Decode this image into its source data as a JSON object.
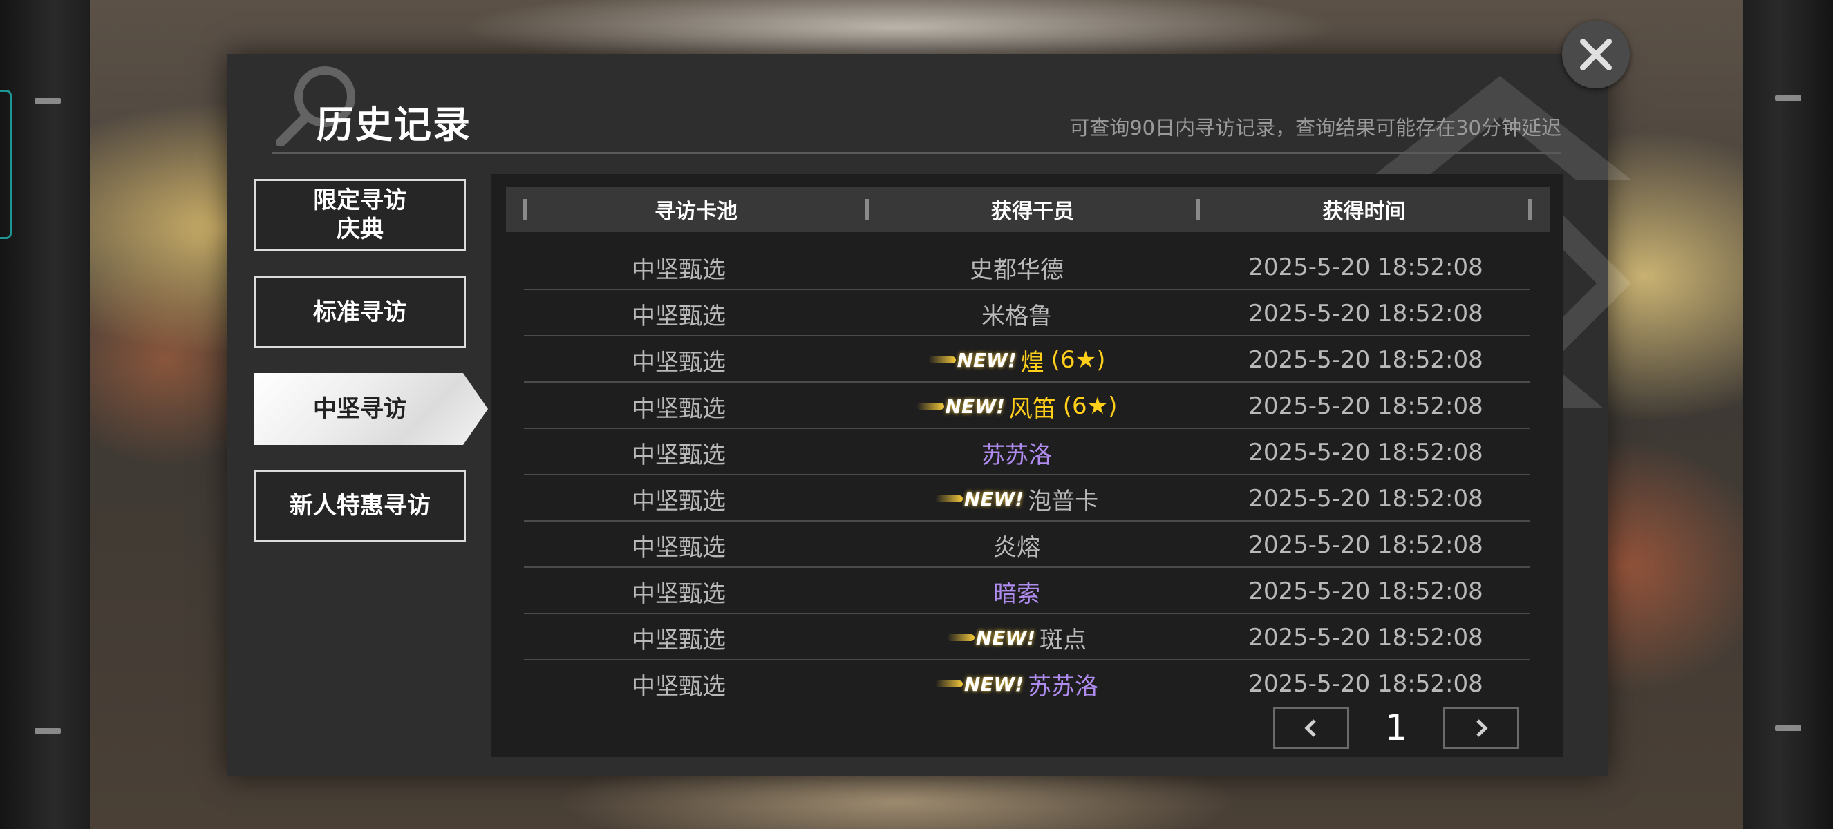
{
  "dialog": {
    "title": "历史记录",
    "subtitle": "可查询90日内寻访记录，查询结果可能存在30分钟延迟"
  },
  "tabs": [
    {
      "label": "限定寻访\n庆典",
      "active": false
    },
    {
      "label": "标准寻访",
      "active": false
    },
    {
      "label": "中坚寻访",
      "active": true
    },
    {
      "label": "新人特惠寻访",
      "active": false
    }
  ],
  "table": {
    "headers": [
      "寻访卡池",
      "获得干员",
      "获得时间"
    ],
    "rows": [
      {
        "pool": "中坚甄选",
        "operator": "史都华德",
        "is_new": false,
        "rarity_label": "",
        "tier": "normal",
        "time": "2025-5-20 18:52:08"
      },
      {
        "pool": "中坚甄选",
        "operator": "米格鲁",
        "is_new": false,
        "rarity_label": "",
        "tier": "normal",
        "time": "2025-5-20 18:52:08"
      },
      {
        "pool": "中坚甄选",
        "operator": "煌",
        "is_new": true,
        "rarity_label": "(6★)",
        "tier": "six",
        "time": "2025-5-20 18:52:08"
      },
      {
        "pool": "中坚甄选",
        "operator": "风笛",
        "is_new": true,
        "rarity_label": "(6★)",
        "tier": "six",
        "time": "2025-5-20 18:52:08"
      },
      {
        "pool": "中坚甄选",
        "operator": "苏苏洛",
        "is_new": false,
        "rarity_label": "",
        "tier": "five",
        "time": "2025-5-20 18:52:08"
      },
      {
        "pool": "中坚甄选",
        "operator": "泡普卡",
        "is_new": true,
        "rarity_label": "",
        "tier": "normal",
        "time": "2025-5-20 18:52:08"
      },
      {
        "pool": "中坚甄选",
        "operator": "炎熔",
        "is_new": false,
        "rarity_label": "",
        "tier": "normal",
        "time": "2025-5-20 18:52:08"
      },
      {
        "pool": "中坚甄选",
        "operator": "暗索",
        "is_new": false,
        "rarity_label": "",
        "tier": "five",
        "time": "2025-5-20 18:52:08"
      },
      {
        "pool": "中坚甄选",
        "operator": "斑点",
        "is_new": true,
        "rarity_label": "",
        "tier": "normal",
        "time": "2025-5-20 18:52:08"
      },
      {
        "pool": "中坚甄选",
        "operator": "苏苏洛",
        "is_new": true,
        "rarity_label": "",
        "tier": "five",
        "time": "2025-5-20 18:52:08"
      }
    ]
  },
  "badge": {
    "new_label": "NEW!"
  },
  "pagination": {
    "current_page": "1"
  },
  "colors": {
    "six_star": "#ffcf1a",
    "five_star": "#b18cf0",
    "normal": "#b9b9b9"
  }
}
